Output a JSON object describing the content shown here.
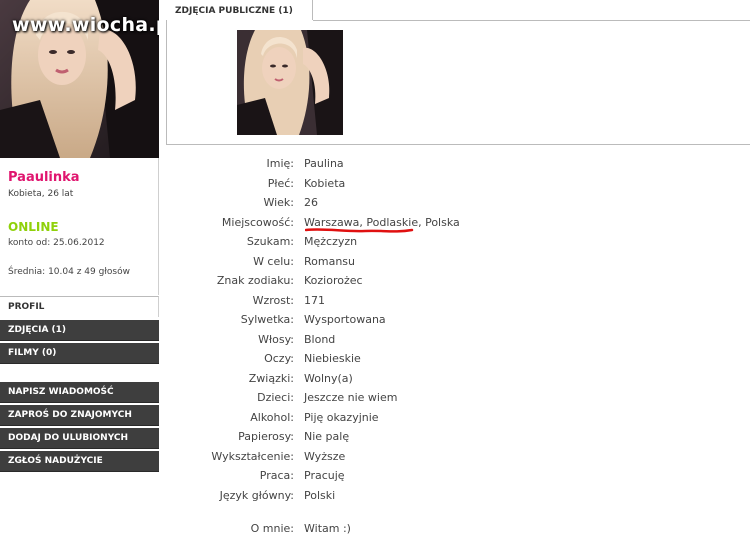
{
  "watermark": "www.wiocha.pl",
  "gallery": {
    "tab_label": "ZDJĘCIA PUBLICZNE (1)"
  },
  "user": {
    "name": "Paaulinka",
    "sex_age": "Kobieta, 26 lat",
    "status": "ONLINE",
    "member_since": "konto od: 25.06.2012",
    "rating": "Średnia: 10.04 z 49 głosów"
  },
  "menu": {
    "profile": "PROFIL",
    "photos": "ZDJĘCIA (1)",
    "films": "FILMY (0)",
    "write_message": "NAPISZ WIADOMOŚĆ",
    "invite": "ZAPROŚ DO ZNAJOMYCH",
    "favorite": "DODAJ DO ULUBIONYCH",
    "report": "ZGŁOŚ NADUŻYCIE"
  },
  "details": [
    {
      "label": "Imię:",
      "value": "Paulina"
    },
    {
      "label": "Płeć:",
      "value": "Kobieta"
    },
    {
      "label": "Wiek:",
      "value": "26"
    },
    {
      "label": "Miejscowość:",
      "value": "Warszawa, Podlaskie, Polska"
    },
    {
      "label": "Szukam:",
      "value": "Mężczyzn"
    },
    {
      "label": "W celu:",
      "value": "Romansu"
    },
    {
      "label": "Znak zodiaku:",
      "value": "Koziorożec"
    },
    {
      "label": "Wzrost:",
      "value": "171"
    },
    {
      "label": "Sylwetka:",
      "value": "Wysportowana"
    },
    {
      "label": "Włosy:",
      "value": "Blond"
    },
    {
      "label": "Oczy:",
      "value": "Niebieskie"
    },
    {
      "label": "Związki:",
      "value": "Wolny(a)"
    },
    {
      "label": "Dzieci:",
      "value": "Jeszcze nie wiem"
    },
    {
      "label": "Alkohol:",
      "value": "Piję okazyjnie"
    },
    {
      "label": "Papierosy:",
      "value": "Nie palę"
    },
    {
      "label": "Wykształcenie:",
      "value": "Wyższe"
    },
    {
      "label": "Praca:",
      "value": "Pracuję"
    },
    {
      "label": "Język główny:",
      "value": "Polski"
    },
    {
      "label": "O mnie:",
      "value": "Witam :)"
    }
  ],
  "colors": {
    "username": "#e0156f",
    "online": "#8fd10a",
    "menu_dark": "#3e3e3e",
    "annotation": "#e01010"
  }
}
